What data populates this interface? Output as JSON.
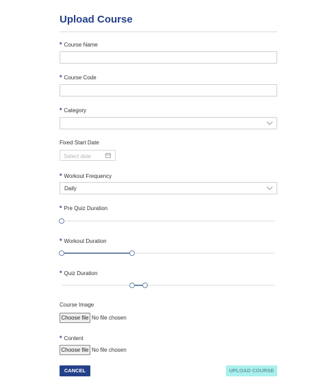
{
  "form": {
    "title": "Upload Course",
    "required_marker": "*",
    "course_name": {
      "label": "Course Name",
      "value": ""
    },
    "course_code": {
      "label": "Course Code",
      "value": ""
    },
    "category": {
      "label": "Category",
      "value": ""
    },
    "fixed_start_date": {
      "label": "Fixed Start Date",
      "placeholder": "Select date"
    },
    "workout_frequency": {
      "label": "Workout Frequency",
      "value": "Daily"
    },
    "pre_quiz_duration": {
      "label": "Pre Quiz Duration",
      "range": [
        0,
        0
      ]
    },
    "workout_duration": {
      "label": "Workout Duration",
      "range": [
        0,
        0.33
      ]
    },
    "quiz_duration": {
      "label": "Quiz Duration",
      "range": [
        0.33,
        0.39
      ]
    },
    "course_image": {
      "label": "Course Image",
      "button": "Choose file",
      "status": "No file chosen"
    },
    "content": {
      "label": "Content",
      "button": "Choose file",
      "status": "No file chosen"
    }
  },
  "actions": {
    "cancel": "CANCEL",
    "upload": "UPLOAD COURSE"
  },
  "colors": {
    "accent": "#24418a",
    "slider": "#6b87a8",
    "upload_bg": "#a9f0ee"
  }
}
